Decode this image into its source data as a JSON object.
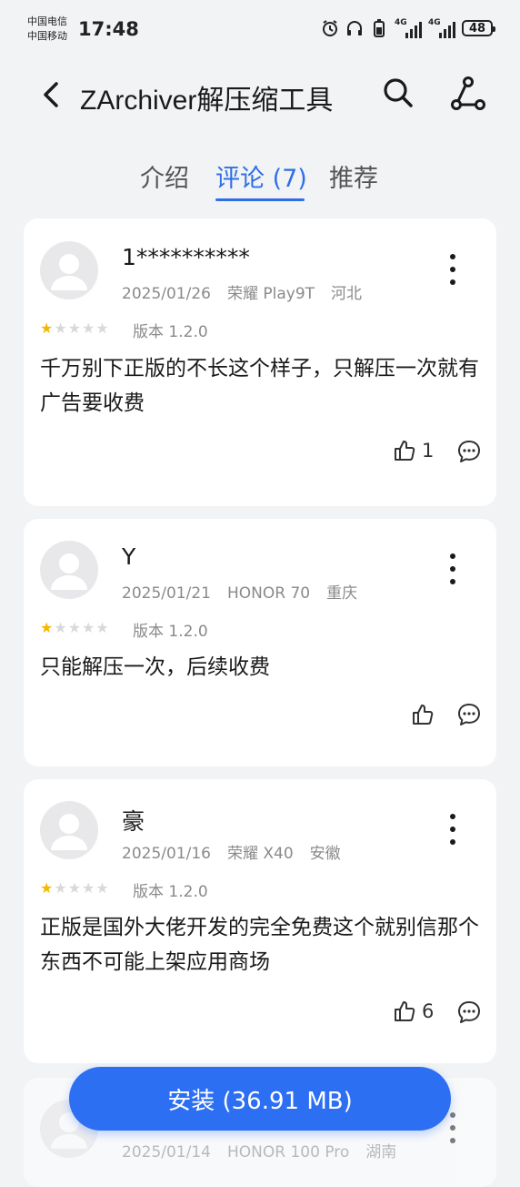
{
  "status": {
    "carrier1": "中国电信",
    "carrier2": "中国移动",
    "time": "17:48",
    "net1": "4G",
    "net2": "4G",
    "battery": "48"
  },
  "header": {
    "title": "ZArchiver解压缩工具"
  },
  "tabs": [
    {
      "label": "介绍"
    },
    {
      "label": "评论 (7)"
    },
    {
      "label": "推荐"
    }
  ],
  "reviews": [
    {
      "user": "1**********",
      "date": "2025/01/26",
      "device": "荣耀 Play9T",
      "region": "河北",
      "rating": 1,
      "version": "版本 1.2.0",
      "text": "千万别下正版的不长这个样子，只解压一次就有广告要收费",
      "likes": "1"
    },
    {
      "user": "Y",
      "date": "2025/01/21",
      "device": "HONOR 70",
      "region": "重庆",
      "rating": 1,
      "version": "版本 1.2.0",
      "text": "只能解压一次，后续收费",
      "likes": ""
    },
    {
      "user": "豪",
      "date": "2025/01/16",
      "device": "荣耀 X40",
      "region": "安徽",
      "rating": 1,
      "version": "版本 1.2.0",
      "text": "正版是国外大佬开发的完全免费这个就别信那个东西不可能上架应用商场",
      "likes": "6"
    },
    {
      "user": "",
      "date": "2025/01/14",
      "device": "HONOR 100 Pro",
      "region": "湖南",
      "rating": 1,
      "version": "",
      "text": "",
      "likes": ""
    }
  ],
  "install_label": "安装 (36.91 MB)"
}
